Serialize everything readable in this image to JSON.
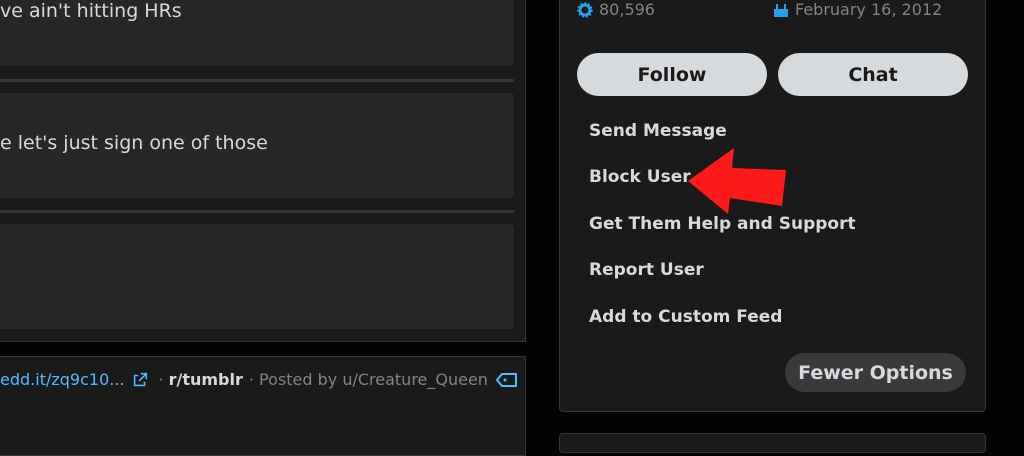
{
  "comments": [
    {
      "text": "ve ain't hitting HRs"
    },
    {
      "text": "e let's just sign one of those"
    }
  ],
  "post": {
    "link_text": "edd.it/zq9c10...",
    "separator": "·",
    "subreddit": "r/tumblr",
    "posted_by": "· Posted by u/Creature_Queen"
  },
  "profile": {
    "karma": "80,596",
    "cake_day": "February 16, 2012",
    "follow_label": "Follow",
    "chat_label": "Chat",
    "menu": [
      {
        "label": "Send Message"
      },
      {
        "label": "Block User"
      },
      {
        "label": "Get Them Help and Support"
      },
      {
        "label": "Report User"
      },
      {
        "label": "Add to Custom Feed"
      }
    ],
    "fewer_options_label": "Fewer Options"
  },
  "colors": {
    "background": "#030303",
    "card": "#1a1a1b",
    "link": "#4fbcff",
    "pill": "#d7dadc",
    "annotation_arrow": "#ff1a1a",
    "karma_icon": "#24a0ed"
  }
}
